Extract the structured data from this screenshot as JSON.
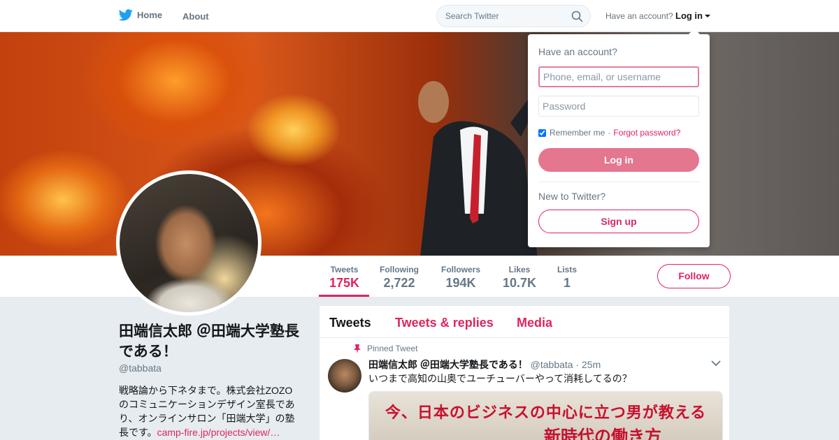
{
  "nav": {
    "home_label": "Home",
    "about_label": "About",
    "search_placeholder": "Search Twitter",
    "have_account": "Have an account?",
    "login_label": "Log in"
  },
  "stats": [
    {
      "label": "Tweets",
      "value": "175K"
    },
    {
      "label": "Following",
      "value": "2,722"
    },
    {
      "label": "Followers",
      "value": "194K"
    },
    {
      "label": "Likes",
      "value": "10.7K"
    },
    {
      "label": "Lists",
      "value": "1"
    }
  ],
  "follow_label": "Follow",
  "profile": {
    "name": "田端信太郎 ＠田端大学塾長である！",
    "handle": "@tabbata",
    "bio": "戦略論から下ネタまで。株式会社ZOZOのコミュニケーションデザイン室長であり、オンラインサロン「田端大学」の塾長です。",
    "bio_link": "camp-fire.jp/projects/view/…"
  },
  "timeline": {
    "tabs": [
      "Tweets",
      "Tweets & replies",
      "Media"
    ],
    "pinned_label": "Pinned Tweet",
    "tweet": {
      "name": "田端信太郎 ＠田端大学塾長である！",
      "handle": "@tabbata",
      "time": "· 25m",
      "text": "いつまで高知の山奥でユーチューバーやって消耗してるの？",
      "media_line1": "今、日本のビジネスの中心に立つ男が教える",
      "media_line2": "新時代の働き方"
    }
  },
  "login_dropdown": {
    "title": "Have an account?",
    "username_placeholder": "Phone, email, or username",
    "password_placeholder": "Password",
    "remember_label": "Remember me",
    "separator": "·",
    "forgot_label": "Forgot password?",
    "login_button": "Log in",
    "new_label": "New to Twitter?",
    "signup_button": "Sign up"
  },
  "colors": {
    "accent": "#e0245e",
    "twitter_blue": "#1da1f2"
  }
}
